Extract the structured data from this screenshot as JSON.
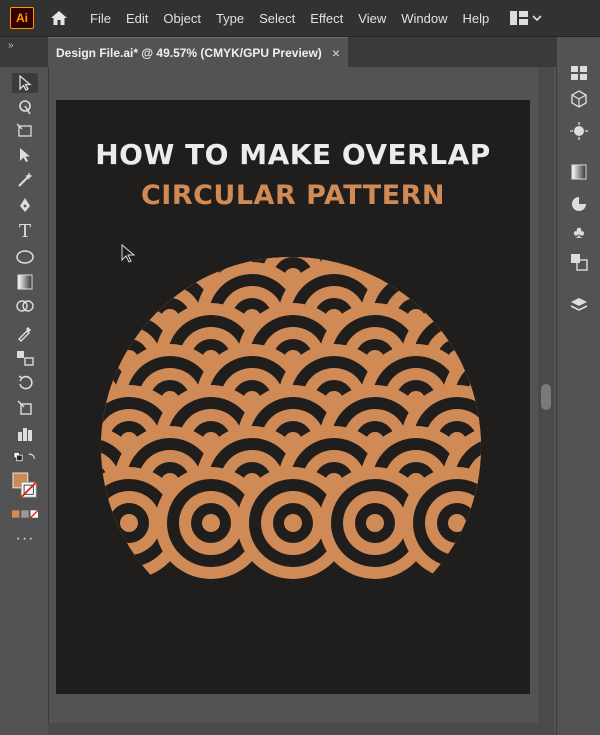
{
  "app": {
    "logo_text": "Ai"
  },
  "menu": [
    "File",
    "Edit",
    "Object",
    "Type",
    "Select",
    "Effect",
    "View",
    "Window",
    "Help"
  ],
  "document_tab": {
    "title": "Design File.ai* @ 49.57% (CMYK/GPU Preview)",
    "close": "×"
  },
  "artwork": {
    "title_line1": "HOW TO MAKE OVERLAP",
    "title_line2": "CIRCULAR PATTERN",
    "colors": {
      "background": "#201e1c",
      "accent": "#d08a56",
      "title": "#ececec"
    }
  },
  "toolbar": {
    "tools": [
      "selection-tool-icon",
      "direct-selection-tool-icon",
      "magic-wand-icon",
      "lasso-icon",
      "pen-icon",
      "curvature-icon",
      "type-tool-icon",
      "ellipse-tool-icon",
      "gradient-icon",
      "shape-builder-icon",
      "eyedropper-icon",
      "blend-icon",
      "rotate-icon",
      "scale-icon",
      "graph-icon",
      "swap-fill-stroke-icon",
      "fill-stroke-swatch",
      "color-mode-icons",
      "more-tools-icon"
    ]
  },
  "right_dock": {
    "panels": [
      "libraries-icon",
      "3d-icon",
      "appearance-icon",
      "gradient-panel-icon",
      "color-icon",
      "symbols-icon",
      "transform-icon",
      "layers-icon"
    ]
  }
}
